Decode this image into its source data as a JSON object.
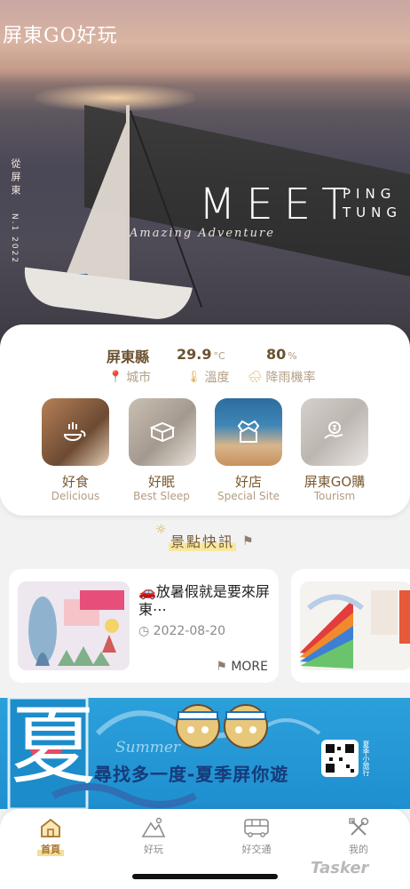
{
  "hero": {
    "brand": "屏東GO好玩",
    "side_vertical": "從屏東",
    "side_number": "N.1 2022",
    "meet": "MEET",
    "ping": "PING",
    "tung": "TUNG",
    "tagline": "Amazing Adventure"
  },
  "weather": {
    "city_value": "屏東縣",
    "city_label": "城市",
    "temp_value": "29.9",
    "temp_unit": "°C",
    "temp_label": "溫度",
    "rain_value": "80",
    "rain_unit": "%",
    "rain_label": "降雨機率"
  },
  "categories": [
    {
      "title": "好食",
      "subtitle": "Delicious",
      "icon": "food-icon"
    },
    {
      "title": "好眠",
      "subtitle": "Best Sleep",
      "icon": "bed-icon"
    },
    {
      "title": "好店",
      "subtitle": "Special Site",
      "icon": "shop-icon"
    },
    {
      "title": "屏東GO購",
      "subtitle": "Tourism",
      "icon": "shopping-bag-icon"
    }
  ],
  "news_section": {
    "title": "景點快訊",
    "items": [
      {
        "emoji": "🚗",
        "title": "放暑假就是要來屏東⋯",
        "date": "2022-08-20",
        "more": "MORE"
      }
    ]
  },
  "banner": {
    "big_char": "夏",
    "summer": "Summer",
    "slogan": "尋找多一度-夏季屏你遊",
    "qr_label": "夏季小旅行"
  },
  "tabs": [
    {
      "label": "首頁",
      "icon": "home-icon",
      "active": true
    },
    {
      "label": "好玩",
      "icon": "mountain-icon",
      "active": false
    },
    {
      "label": "好交通",
      "icon": "bus-icon",
      "active": false
    },
    {
      "label": "我的",
      "icon": "tools-icon",
      "active": false
    }
  ],
  "watermark": "Tasker",
  "colors": {
    "accent": "#a8752c",
    "brown": "#7a5a31",
    "icon_orange": "#e3a64b",
    "banner_blue": "#1f8fcf"
  }
}
